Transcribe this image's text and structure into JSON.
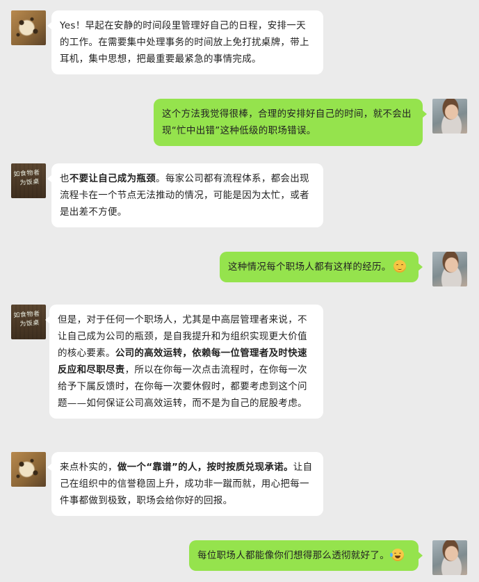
{
  "messages": [
    {
      "side": "left",
      "avatar": "cheetah-avatar",
      "segments": [
        {
          "text": "Yes！早起在安静的时间段里管理好自己的日程，安排一天的工作。在需要集中处理事务的时间放上免打扰桌牌，带上耳机，集中思想，把最重要最紧急的事情完成。",
          "bold": false
        }
      ]
    },
    {
      "side": "right",
      "avatar": "girl-avatar",
      "segments": [
        {
          "text": "这个方法我觉得很棒，合理的安排好自己的时间，就不会出现“忙中出错”这种低级的职场错误。",
          "bold": false
        }
      ]
    },
    {
      "side": "left",
      "avatar": "chalkboard-avatar",
      "avatar_text": [
        "如食物者",
        "为饭桌"
      ],
      "segments": [
        {
          "text": "也",
          "bold": false
        },
        {
          "text": "不要让自己成为瓶颈",
          "bold": true
        },
        {
          "text": "。每家公司都有流程体系，都会出现流程卡在一个节点无法推动的情况，可能是因为太忙，或者是出差不方便。",
          "bold": false
        }
      ]
    },
    {
      "side": "right",
      "avatar": "girl-avatar",
      "emoji": "smile-emoji",
      "segments": [
        {
          "text": "这种情况每个职场人都有这样的经历。",
          "bold": false
        }
      ]
    },
    {
      "side": "left",
      "avatar": "chalkboard-avatar",
      "avatar_text": [
        "如食物者",
        "为饭桌"
      ],
      "segments": [
        {
          "text": "但是，对于任何一个职场人，尤其是中高层管理者来说，不让自己成为公司的瓶颈，是自我提升和为组织实现更大价值的核心要素。",
          "bold": false
        },
        {
          "text": "公司的高效运转，依赖每一位管理者及时快速反应和尽职尽责",
          "bold": true
        },
        {
          "text": "，所以在你每一次点击流程时，在你每一次给予下属反馈时，在你每一次要休假时，都要考虑到这个问题——如何保证公司高效运转，而不是为自己的屁股考虑。",
          "bold": false
        }
      ]
    },
    {
      "side": "left",
      "avatar": "cheetah-avatar",
      "segments": [
        {
          "text": "来点朴实的，",
          "bold": false
        },
        {
          "text": "做一个“靠谱”的人，按时按质兑现承诺。",
          "bold": true
        },
        {
          "text": "让自己在组织中的信誉稳固上升，成功非一蹴而就，用心把每一件事都做到极致，职场会给你好的回报。",
          "bold": false
        }
      ]
    },
    {
      "side": "right",
      "avatar": "girl-avatar",
      "emoji": "laugh-emoji",
      "segments": [
        {
          "text": "每位职场人都能像你们想得那么透彻就好了。",
          "bold": false
        }
      ]
    }
  ]
}
